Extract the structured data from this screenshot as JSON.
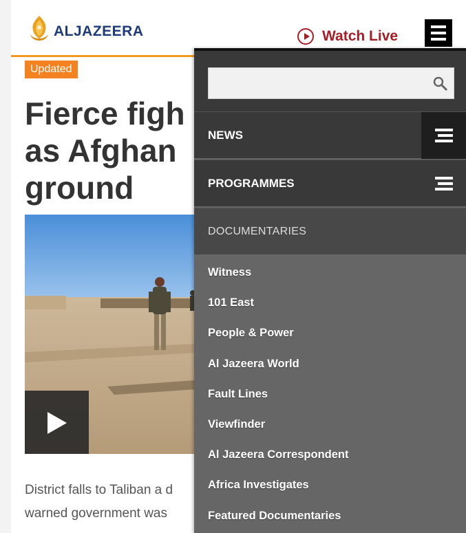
{
  "brand": {
    "logo_text": "ALJAZEERA",
    "logo_color": "#1d3a7a"
  },
  "header": {
    "watch_live": "Watch Live",
    "accent": "#a61d26"
  },
  "article": {
    "badge": "Updated",
    "headline_lines": [
      "Fierce figh",
      "as Afghan",
      "ground"
    ],
    "summary_lines": [
      "District falls to Taliban a d",
      "warned government was"
    ]
  },
  "nav": {
    "search": {
      "value": "",
      "placeholder": ""
    },
    "items": [
      {
        "label": "NEWS"
      },
      {
        "label": "PROGRAMMES"
      }
    ],
    "section": {
      "label": "DOCUMENTARIES",
      "items": [
        "Witness",
        "101 East",
        "People & Power",
        "Al Jazeera World",
        "Fault Lines",
        "Viewfinder",
        "Al Jazeera Correspondent",
        "Africa Investigates",
        "Featured Documentaries"
      ]
    }
  },
  "colors": {
    "updated_badge": "#f58220",
    "rule": "#f29a1f",
    "nav_dark": "#393939",
    "nav_light": "#666666"
  }
}
